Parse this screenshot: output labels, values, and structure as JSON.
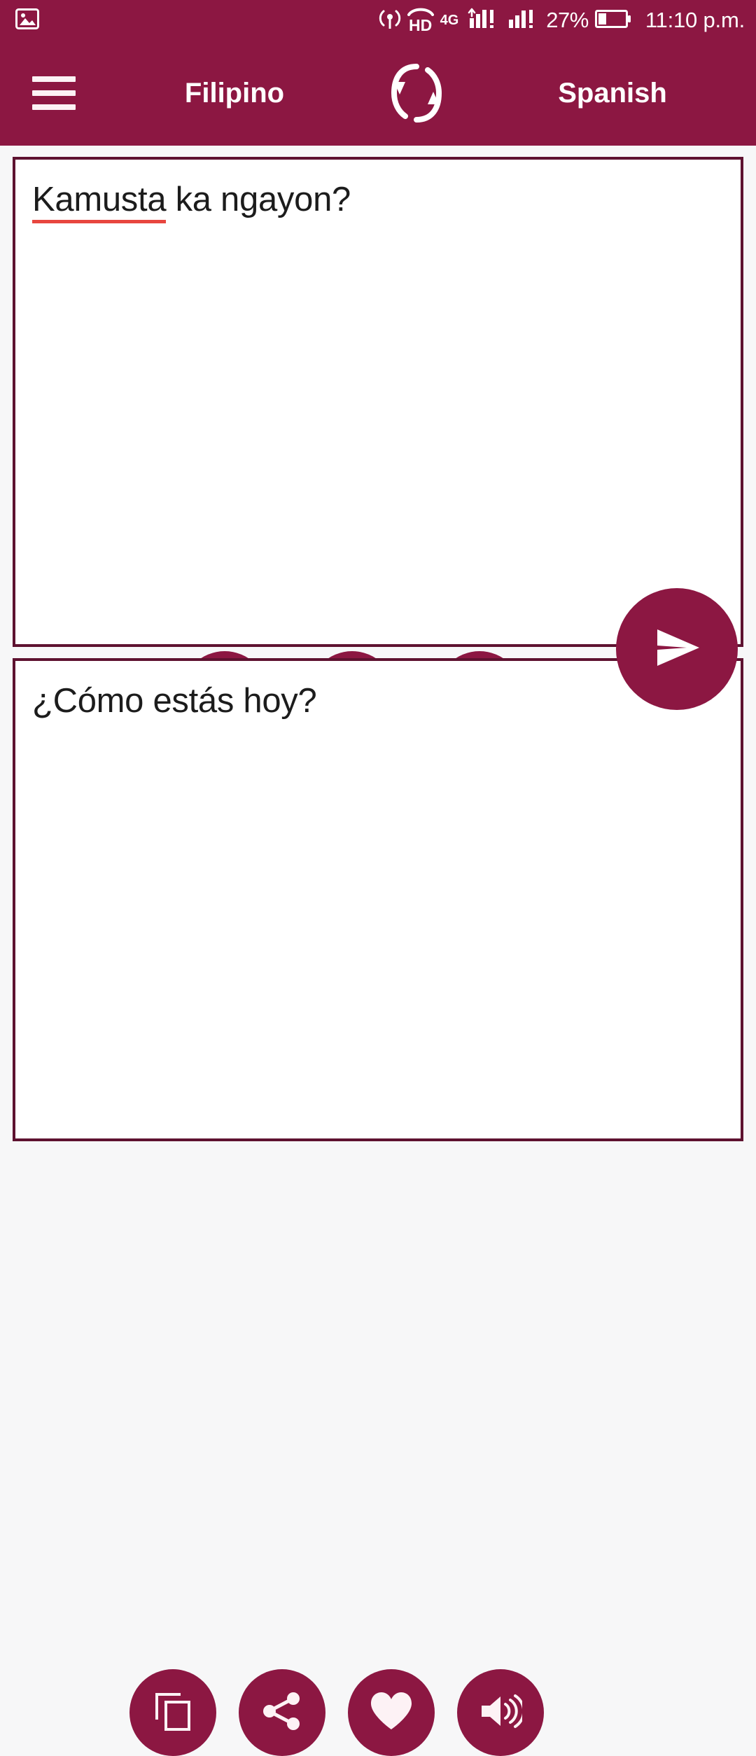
{
  "status_bar": {
    "notification_icon": "image-icon",
    "icons": [
      "hotspot-icon",
      "hd-voice-icon",
      "network-4g-icon",
      "signal-bars-sim1-icon",
      "signal-bars-sim2-icon"
    ],
    "hd_label": "HD",
    "network_label": "4G",
    "battery_percent": "27%",
    "battery_icon": "battery-low-icon",
    "time": "11:10 p.m."
  },
  "app_bar": {
    "menu_label": "menu-icon",
    "source_language": "Filipino",
    "swap_label": "swap-languages-icon",
    "target_language": "Spanish"
  },
  "source_panel": {
    "text_misspelled": "Kamusta",
    "text_rest": " ka ngayon?",
    "actions": [
      {
        "name": "microphone-button",
        "icon": "microphone-icon"
      },
      {
        "name": "speak-source-button",
        "icon": "speaker-icon"
      },
      {
        "name": "clear-text-button",
        "icon": "close-icon"
      }
    ]
  },
  "send_button": {
    "name": "send-translate-button",
    "icon": "send-icon"
  },
  "target_panel": {
    "text": "¿Cómo estás hoy?",
    "actions": [
      {
        "name": "copy-button",
        "icon": "copy-icon"
      },
      {
        "name": "share-button",
        "icon": "share-icon"
      },
      {
        "name": "favorite-button",
        "icon": "heart-icon"
      },
      {
        "name": "speak-translation-button",
        "icon": "speaker-icon"
      }
    ]
  },
  "colors": {
    "brand": "#8c1742",
    "border": "#5e1230",
    "page_background": "#f7f7f8",
    "panel_background": "#ffffff",
    "spellcheck_underline": "#e8463f",
    "on_brand": "#ffffff"
  }
}
